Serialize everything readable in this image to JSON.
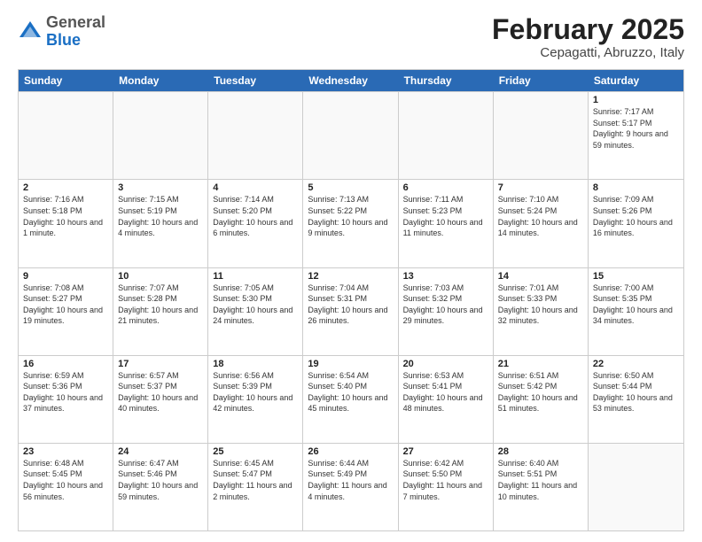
{
  "logo": {
    "general": "General",
    "blue": "Blue"
  },
  "title": "February 2025",
  "subtitle": "Cepagatti, Abruzzo, Italy",
  "days": [
    "Sunday",
    "Monday",
    "Tuesday",
    "Wednesday",
    "Thursday",
    "Friday",
    "Saturday"
  ],
  "weeks": [
    [
      {
        "day": "",
        "info": ""
      },
      {
        "day": "",
        "info": ""
      },
      {
        "day": "",
        "info": ""
      },
      {
        "day": "",
        "info": ""
      },
      {
        "day": "",
        "info": ""
      },
      {
        "day": "",
        "info": ""
      },
      {
        "day": "1",
        "info": "Sunrise: 7:17 AM\nSunset: 5:17 PM\nDaylight: 9 hours and 59 minutes."
      }
    ],
    [
      {
        "day": "2",
        "info": "Sunrise: 7:16 AM\nSunset: 5:18 PM\nDaylight: 10 hours and 1 minute."
      },
      {
        "day": "3",
        "info": "Sunrise: 7:15 AM\nSunset: 5:19 PM\nDaylight: 10 hours and 4 minutes."
      },
      {
        "day": "4",
        "info": "Sunrise: 7:14 AM\nSunset: 5:20 PM\nDaylight: 10 hours and 6 minutes."
      },
      {
        "day": "5",
        "info": "Sunrise: 7:13 AM\nSunset: 5:22 PM\nDaylight: 10 hours and 9 minutes."
      },
      {
        "day": "6",
        "info": "Sunrise: 7:11 AM\nSunset: 5:23 PM\nDaylight: 10 hours and 11 minutes."
      },
      {
        "day": "7",
        "info": "Sunrise: 7:10 AM\nSunset: 5:24 PM\nDaylight: 10 hours and 14 minutes."
      },
      {
        "day": "8",
        "info": "Sunrise: 7:09 AM\nSunset: 5:26 PM\nDaylight: 10 hours and 16 minutes."
      }
    ],
    [
      {
        "day": "9",
        "info": "Sunrise: 7:08 AM\nSunset: 5:27 PM\nDaylight: 10 hours and 19 minutes."
      },
      {
        "day": "10",
        "info": "Sunrise: 7:07 AM\nSunset: 5:28 PM\nDaylight: 10 hours and 21 minutes."
      },
      {
        "day": "11",
        "info": "Sunrise: 7:05 AM\nSunset: 5:30 PM\nDaylight: 10 hours and 24 minutes."
      },
      {
        "day": "12",
        "info": "Sunrise: 7:04 AM\nSunset: 5:31 PM\nDaylight: 10 hours and 26 minutes."
      },
      {
        "day": "13",
        "info": "Sunrise: 7:03 AM\nSunset: 5:32 PM\nDaylight: 10 hours and 29 minutes."
      },
      {
        "day": "14",
        "info": "Sunrise: 7:01 AM\nSunset: 5:33 PM\nDaylight: 10 hours and 32 minutes."
      },
      {
        "day": "15",
        "info": "Sunrise: 7:00 AM\nSunset: 5:35 PM\nDaylight: 10 hours and 34 minutes."
      }
    ],
    [
      {
        "day": "16",
        "info": "Sunrise: 6:59 AM\nSunset: 5:36 PM\nDaylight: 10 hours and 37 minutes."
      },
      {
        "day": "17",
        "info": "Sunrise: 6:57 AM\nSunset: 5:37 PM\nDaylight: 10 hours and 40 minutes."
      },
      {
        "day": "18",
        "info": "Sunrise: 6:56 AM\nSunset: 5:39 PM\nDaylight: 10 hours and 42 minutes."
      },
      {
        "day": "19",
        "info": "Sunrise: 6:54 AM\nSunset: 5:40 PM\nDaylight: 10 hours and 45 minutes."
      },
      {
        "day": "20",
        "info": "Sunrise: 6:53 AM\nSunset: 5:41 PM\nDaylight: 10 hours and 48 minutes."
      },
      {
        "day": "21",
        "info": "Sunrise: 6:51 AM\nSunset: 5:42 PM\nDaylight: 10 hours and 51 minutes."
      },
      {
        "day": "22",
        "info": "Sunrise: 6:50 AM\nSunset: 5:44 PM\nDaylight: 10 hours and 53 minutes."
      }
    ],
    [
      {
        "day": "23",
        "info": "Sunrise: 6:48 AM\nSunset: 5:45 PM\nDaylight: 10 hours and 56 minutes."
      },
      {
        "day": "24",
        "info": "Sunrise: 6:47 AM\nSunset: 5:46 PM\nDaylight: 10 hours and 59 minutes."
      },
      {
        "day": "25",
        "info": "Sunrise: 6:45 AM\nSunset: 5:47 PM\nDaylight: 11 hours and 2 minutes."
      },
      {
        "day": "26",
        "info": "Sunrise: 6:44 AM\nSunset: 5:49 PM\nDaylight: 11 hours and 4 minutes."
      },
      {
        "day": "27",
        "info": "Sunrise: 6:42 AM\nSunset: 5:50 PM\nDaylight: 11 hours and 7 minutes."
      },
      {
        "day": "28",
        "info": "Sunrise: 6:40 AM\nSunset: 5:51 PM\nDaylight: 11 hours and 10 minutes."
      },
      {
        "day": "",
        "info": ""
      }
    ]
  ]
}
